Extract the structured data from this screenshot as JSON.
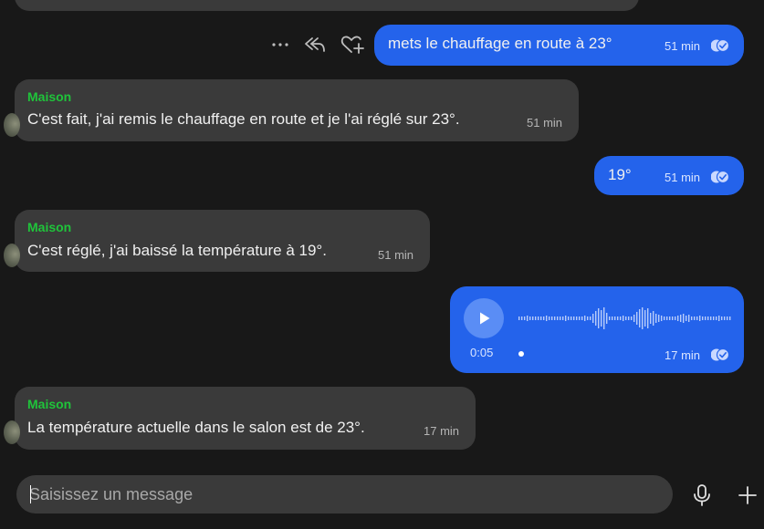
{
  "colors": {
    "background": "#181818",
    "incoming_bubble": "#3a3a3a",
    "outgoing_bubble": "#2463eb",
    "sender_name": "#1fc43a"
  },
  "messages": [
    {
      "direction": "out",
      "text": "mets le chauffage en route à 23°",
      "time": "51 min",
      "status": "read",
      "status_icon": "double-check-icon"
    },
    {
      "direction": "in",
      "sender": "Maison",
      "text": "C'est fait, j'ai remis le chauffage en route et je l'ai réglé sur 23°.",
      "time": "51 min"
    },
    {
      "direction": "out",
      "text": "19°",
      "time": "51 min",
      "status": "read",
      "status_icon": "double-check-icon"
    },
    {
      "direction": "in",
      "sender": "Maison",
      "text": "C'est réglé, j'ai baissé la température à 19°.",
      "time": "51 min"
    },
    {
      "direction": "out",
      "type": "voice",
      "duration": "0:05",
      "time": "17 min",
      "status": "read",
      "status_icon": "double-check-icon",
      "play_icon": "play-icon"
    },
    {
      "direction": "in",
      "sender": "Maison",
      "text": "La température actuelle dans le salon est de 23°.",
      "time": "17 min"
    }
  ],
  "message_actions": {
    "icons": [
      "more-options-icon",
      "reply-icon",
      "add-reaction-icon"
    ]
  },
  "composer": {
    "placeholder": "Saisissez un message",
    "value": "",
    "mic_icon": "microphone-icon",
    "attach_icon": "plus-icon"
  }
}
